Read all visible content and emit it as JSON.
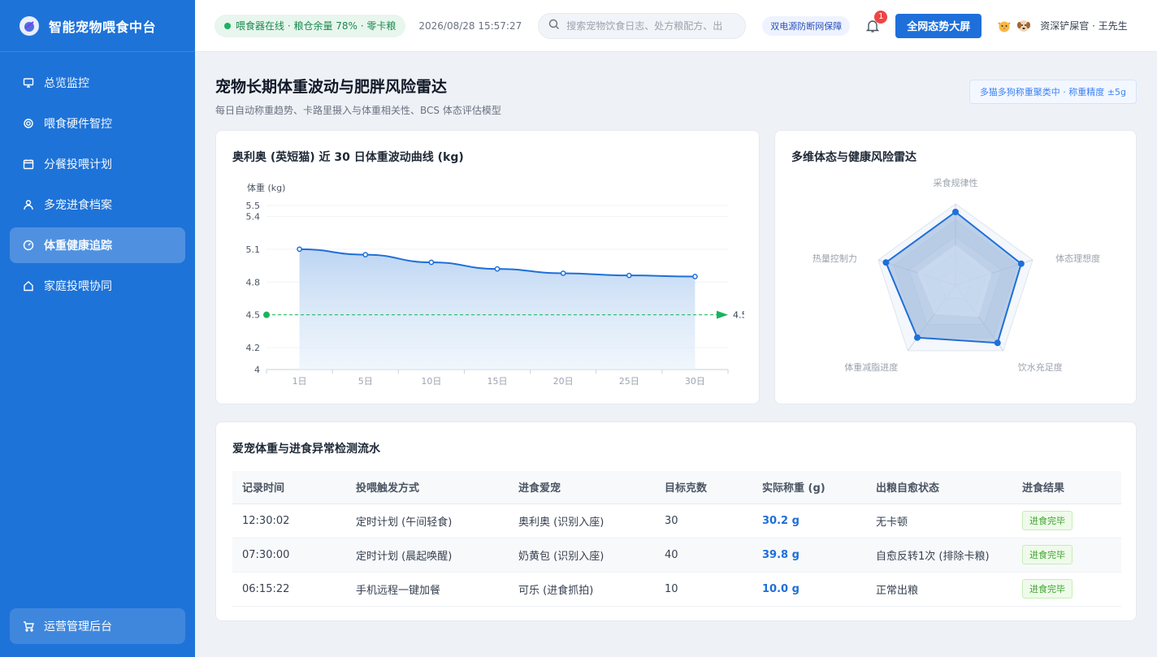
{
  "app": {
    "title": "智能宠物喂食中台"
  },
  "sidebar": {
    "items": [
      {
        "label": "总览监控",
        "icon": "monitor-icon"
      },
      {
        "label": "喂食硬件智控",
        "icon": "gear-icon"
      },
      {
        "label": "分餐投喂计划",
        "icon": "calendar-icon"
      },
      {
        "label": "多宠进食档案",
        "icon": "user-icon"
      },
      {
        "label": "体重健康追踪",
        "icon": "gauge-icon",
        "active": true
      },
      {
        "label": "家庭投喂协同",
        "icon": "home-icon"
      }
    ],
    "bottom": {
      "label": "运营管理后台",
      "icon": "cart-icon"
    }
  },
  "topbar": {
    "status": "喂食器在线 · 粮仓余量 78% · 零卡粮",
    "datetime": "2026/08/28 15:57:27",
    "search_placeholder": "搜索宠物饮食日志、处方粮配方、出",
    "power_badge": "双电源防断网保障",
    "notification_count": "1",
    "screen_button": "全网态势大屏",
    "user": "资深铲屎官 · 王先生"
  },
  "page": {
    "title": "宠物长期体重波动与肥胖风险雷达",
    "subtitle": "每日自动称重趋势、卡路里摄入与体重相关性、BCS 体态评估模型",
    "precision_badge": "多猫多狗称重聚类中 · 称重精度 ±5g"
  },
  "weight_chart": {
    "title": "奥利奥 (英短猫) 近 30 日体重波动曲线 (kg)"
  },
  "radar": {
    "title": "多维体态与健康风险雷达"
  },
  "chart_data": [
    {
      "type": "line",
      "title": "奥利奥 (英短猫) 近 30 日体重波动曲线 (kg)",
      "ylabel": "体重 (kg)",
      "categories": [
        "1日",
        "5日",
        "10日",
        "15日",
        "20日",
        "25日",
        "30日"
      ],
      "values": [
        5.1,
        5.05,
        4.98,
        4.92,
        4.88,
        4.86,
        4.85
      ],
      "yticks": [
        "4",
        "4.2",
        "4.5",
        "4.8",
        "5.1",
        "5.4",
        "5.5"
      ],
      "ylim": [
        4,
        5.5
      ],
      "target_line": {
        "value": 4.5,
        "label": "4.5"
      },
      "area_fill": true,
      "grid": true,
      "colors": {
        "line": "#1e6fd9",
        "target": "#19b35f"
      }
    },
    {
      "type": "radar",
      "title": "多维体态与健康风险雷达",
      "axes": [
        "采食规律性",
        "体态理想度",
        "饮水充足度",
        "体重减脂进度",
        "热量控制力"
      ],
      "values": [
        90,
        85,
        88,
        80,
        90
      ],
      "max": 100,
      "colors": {
        "line": "#1e6fd9",
        "fill": "#8fb0d8"
      }
    }
  ],
  "table": {
    "title": "爱宠体重与进食异常检测流水",
    "headers": [
      "记录时间",
      "投喂触发方式",
      "进食爱宠",
      "目标克数",
      "实际称重 (g)",
      "出粮自愈状态",
      "进食结果"
    ],
    "rows": [
      [
        "12:30:02",
        "定时计划 (午间轻食)",
        "奥利奥 (识别入座)",
        "30",
        "30.2 g",
        "无卡顿",
        "进食完毕"
      ],
      [
        "07:30:00",
        "定时计划 (晨起唤醒)",
        "奶黄包 (识别入座)",
        "40",
        "39.8 g",
        "自愈反转1次 (排除卡粮)",
        "进食完毕"
      ],
      [
        "06:15:22",
        "手机远程一键加餐",
        "可乐 (进食抓拍)",
        "10",
        "10.0 g",
        "正常出粮",
        "进食完毕"
      ]
    ]
  }
}
